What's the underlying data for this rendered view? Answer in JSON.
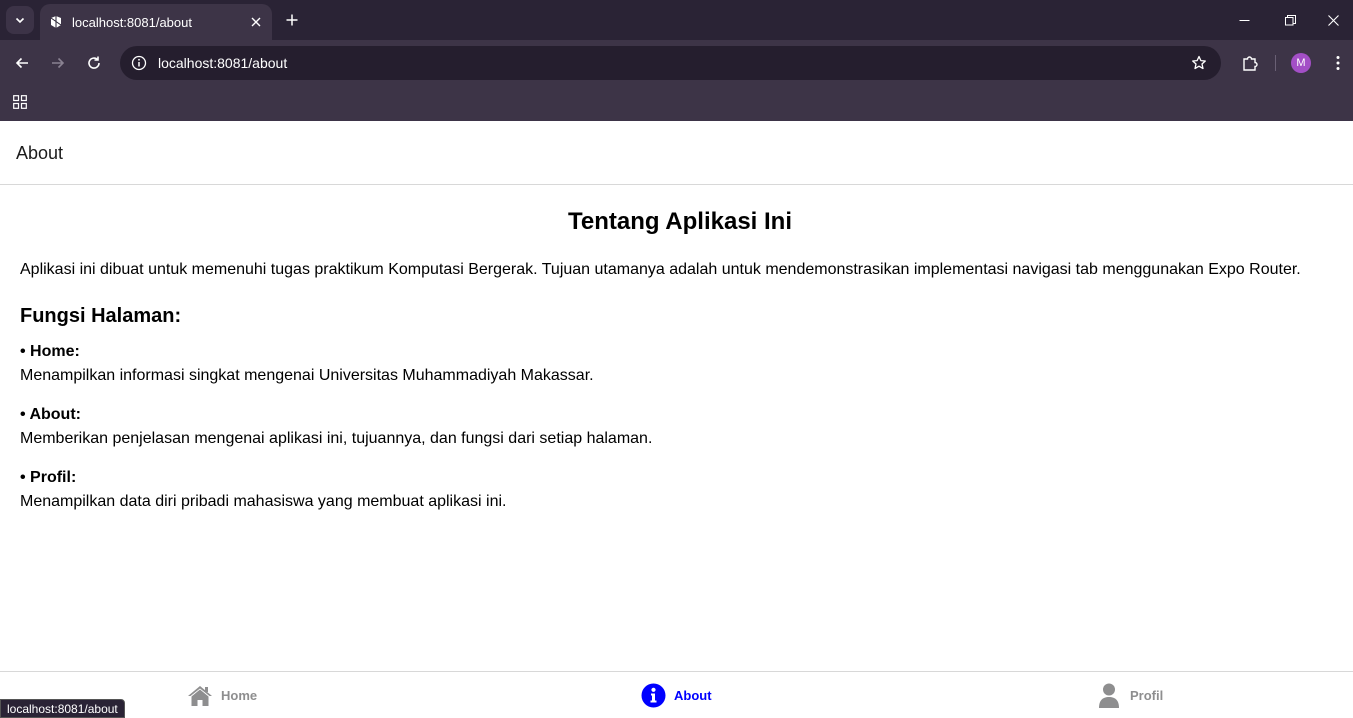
{
  "browser": {
    "tab_title": "localhost:8081/about",
    "url": "localhost:8081/about",
    "avatar_letter": "M",
    "status_url": "localhost:8081/about"
  },
  "app": {
    "header_title": "About",
    "page_title": "Tentang Aplikasi Ini",
    "intro": "Aplikasi ini dibuat untuk memenuhi tugas praktikum Komputasi Bergerak. Tujuan utamanya adalah untuk mendemonstrasikan implementasi navigasi tab menggunakan Expo Router.",
    "section_title": "Fungsi Halaman:",
    "functions": [
      {
        "name": "• Home:",
        "desc": "Menampilkan informasi singkat mengenai Universitas Muhammadiyah Makassar."
      },
      {
        "name": "• About:",
        "desc": "Memberikan penjelasan mengenai aplikasi ini, tujuannya, dan fungsi dari setiap halaman."
      },
      {
        "name": "• Profil:",
        "desc": "Menampilkan data diri pribadi mahasiswa yang membuat aplikasi ini."
      }
    ]
  },
  "tabs": [
    {
      "label": "Home",
      "icon": "home-icon",
      "active": false
    },
    {
      "label": "About",
      "icon": "info-icon",
      "active": true
    },
    {
      "label": "Profil",
      "icon": "user-icon",
      "active": false
    }
  ],
  "colors": {
    "active_tab": "#0000ff",
    "inactive_tab": "#8e8e8f",
    "chrome_bg": "#2a2335",
    "toolbar_bg": "#3d3447"
  }
}
